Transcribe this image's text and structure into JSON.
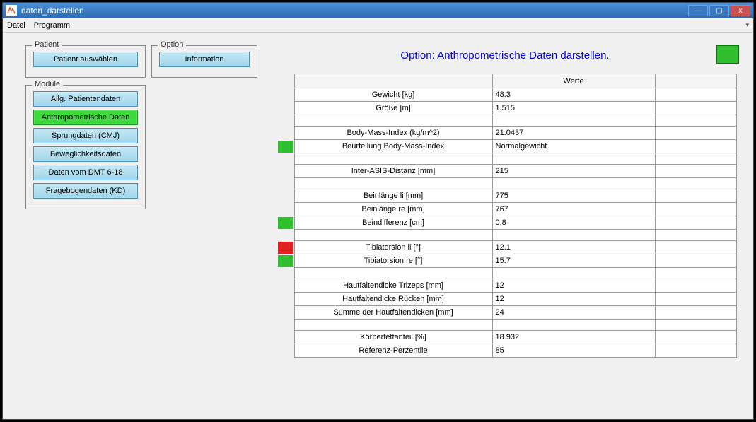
{
  "window": {
    "title": "daten_darstellen",
    "minimize_glyph": "—",
    "maximize_glyph": "▢",
    "close_glyph": "x"
  },
  "menu": {
    "items": [
      "Datei",
      "Programm"
    ]
  },
  "patient_box": {
    "legend": "Patient",
    "select_button": "Patient auswählen"
  },
  "option_box": {
    "legend": "Option",
    "info_button": "Information"
  },
  "module_box": {
    "legend": "Module",
    "buttons": [
      {
        "label": "Allg. Patientendaten",
        "active": false
      },
      {
        "label": "Anthropometrische Daten",
        "active": true
      },
      {
        "label": "Sprungdaten (CMJ)",
        "active": false
      },
      {
        "label": "Beweglichkeitsdaten",
        "active": false
      },
      {
        "label": "Daten vom DMT 6-18",
        "active": false
      },
      {
        "label": "Fragebogendaten (KD)",
        "active": false
      }
    ]
  },
  "header": "Option: Anthropometrische Daten darstellen.",
  "status_indicator_color": "green",
  "table": {
    "header_values": "Werte",
    "rows": [
      {
        "label": "Gewicht [kg]",
        "value": "48.3",
        "flag": ""
      },
      {
        "label": "Größe [m]",
        "value": "1.515",
        "flag": ""
      },
      {
        "spacer": true
      },
      {
        "label": "Body-Mass-Index (kg/m^2)",
        "value": "21.0437",
        "flag": ""
      },
      {
        "label": "Beurteilung Body-Mass-Index",
        "value": "Normalgewicht",
        "flag": "green"
      },
      {
        "spacer": true
      },
      {
        "label": "Inter-ASIS-Distanz [mm]",
        "value": "215",
        "flag": ""
      },
      {
        "spacer": true
      },
      {
        "label": "Beinlänge li [mm]",
        "value": "775",
        "flag": ""
      },
      {
        "label": "Beinlänge re [mm]",
        "value": "767",
        "flag": ""
      },
      {
        "label": "Beindifferenz [cm]",
        "value": "0.8",
        "flag": "green"
      },
      {
        "spacer": true
      },
      {
        "label": "Tibiatorsion li [°]",
        "value": "12.1",
        "flag": "red"
      },
      {
        "label": "Tibiatorsion re [°]",
        "value": "15.7",
        "flag": "green"
      },
      {
        "spacer": true
      },
      {
        "label": "Hautfaltendicke Trizeps [mm]",
        "value": "12",
        "flag": ""
      },
      {
        "label": "Hautfaltendicke Rücken [mm]",
        "value": "12",
        "flag": ""
      },
      {
        "label": "Summe der Hautfaltendicken [mm]",
        "value": "24",
        "flag": ""
      },
      {
        "spacer": true
      },
      {
        "label": "Körperfettanteil [%]",
        "value": "18.932",
        "flag": ""
      },
      {
        "label": "Referenz-Perzentile",
        "value": "85",
        "flag": ""
      }
    ]
  }
}
